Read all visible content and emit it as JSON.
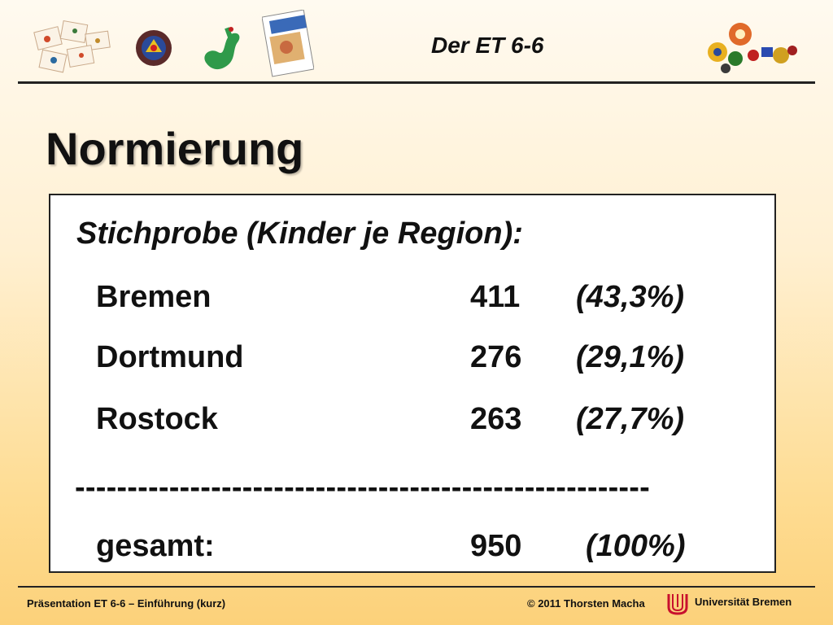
{
  "header": {
    "title": "Der ET 6-6"
  },
  "slide": {
    "title": "Normierung"
  },
  "sample": {
    "heading": "Stichprobe (Kinder je Region):",
    "rows": [
      {
        "name": "Bremen",
        "count": "411",
        "percent": "(43,3%)"
      },
      {
        "name": "Dortmund",
        "count": "276",
        "percent": "(29,1%)"
      },
      {
        "name": "Rostock",
        "count": "263",
        "percent": "(27,7%)"
      }
    ],
    "separator": "-------------------------------------------------------",
    "total": {
      "name": "gesamt:",
      "count": "950",
      "percent": "(100%)"
    }
  },
  "footer": {
    "left": "Präsentation ET 6-6 – Einführung (kurz)",
    "copyright": "© 2011 Thorsten Macha",
    "university": "Universität Bremen"
  },
  "colors": {
    "background_top": "#fffaf0",
    "background_bottom": "#fcd17a",
    "text": "#111111",
    "logo_red": "#c8102e"
  }
}
